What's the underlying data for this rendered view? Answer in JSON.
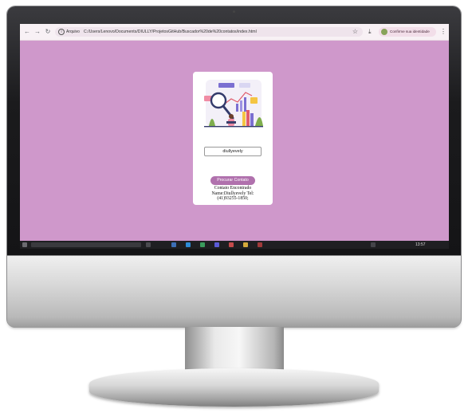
{
  "browser": {
    "back_icon": "arrow-left-icon",
    "forward_icon": "arrow-right-icon",
    "reload_icon": "reload-icon",
    "site_info_label": "Arquivo",
    "url": "C:/Users/Lenovo/Documents/DIULLY/ProjetosGitHub/Buscador%20de%20contatos/index.html",
    "identity_button_label": "Confirme sua identidade",
    "colors": {
      "bar": "#f8f1f5",
      "identity_chip": "#f2dee9"
    }
  },
  "page": {
    "background_color": "#cf98cb",
    "illustration_icon": "search-analytics-illustration",
    "search_value": "diullyevely",
    "search_button_label": "Procurar Contato",
    "result_lines": [
      "Contato Encontrado",
      "Name:Diullyevely Tel:",
      "(41)93255-1850;"
    ],
    "button_color": "#b071ad"
  },
  "taskbar": {
    "clock": "13:57"
  }
}
